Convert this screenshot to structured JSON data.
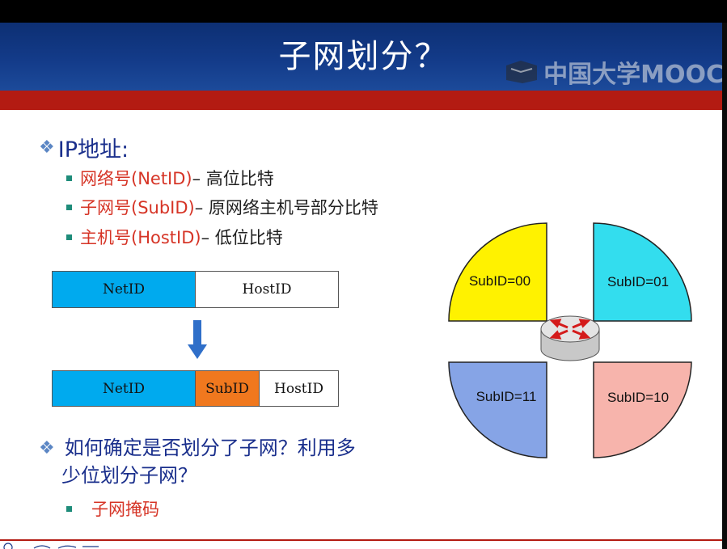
{
  "slide": {
    "title": "子网划分？",
    "watermark": "中国大学MOOC"
  },
  "bullets": {
    "ip_heading": "IP地址:",
    "items": [
      {
        "label": "网络号(NetID)",
        "rest": " – 高位比特"
      },
      {
        "label": "子网号(SubID)",
        "rest": " – 原网络主机号部分比特"
      },
      {
        "label": "主机号(HostID)",
        "rest": " – 低位比特"
      }
    ],
    "question_line1": "如何确定是否划分了子网？利用多",
    "question_line2": "少位划分子网？",
    "answer": "子网掩码"
  },
  "address_diagram": {
    "before": [
      "NetID",
      "HostID"
    ],
    "after": [
      "NetID",
      "SubID",
      "HostID"
    ]
  },
  "quadrants": [
    {
      "label": "SubID=00",
      "color": "#fff200"
    },
    {
      "label": "SubID=01",
      "color": "#33ddee"
    },
    {
      "label": "SubID=11",
      "color": "#86a4e6"
    },
    {
      "label": "SubID=10",
      "color": "#f7b4ac"
    }
  ],
  "colors": {
    "title_band": "#133b89",
    "accent_red": "#b31b12",
    "netid": "#00aaee",
    "subid": "#f0781e",
    "arrow": "#2f6fc9"
  },
  "icons": [
    "diamond-bullet-icon",
    "square-bullet-icon",
    "down-arrow-icon",
    "router-icon"
  ]
}
